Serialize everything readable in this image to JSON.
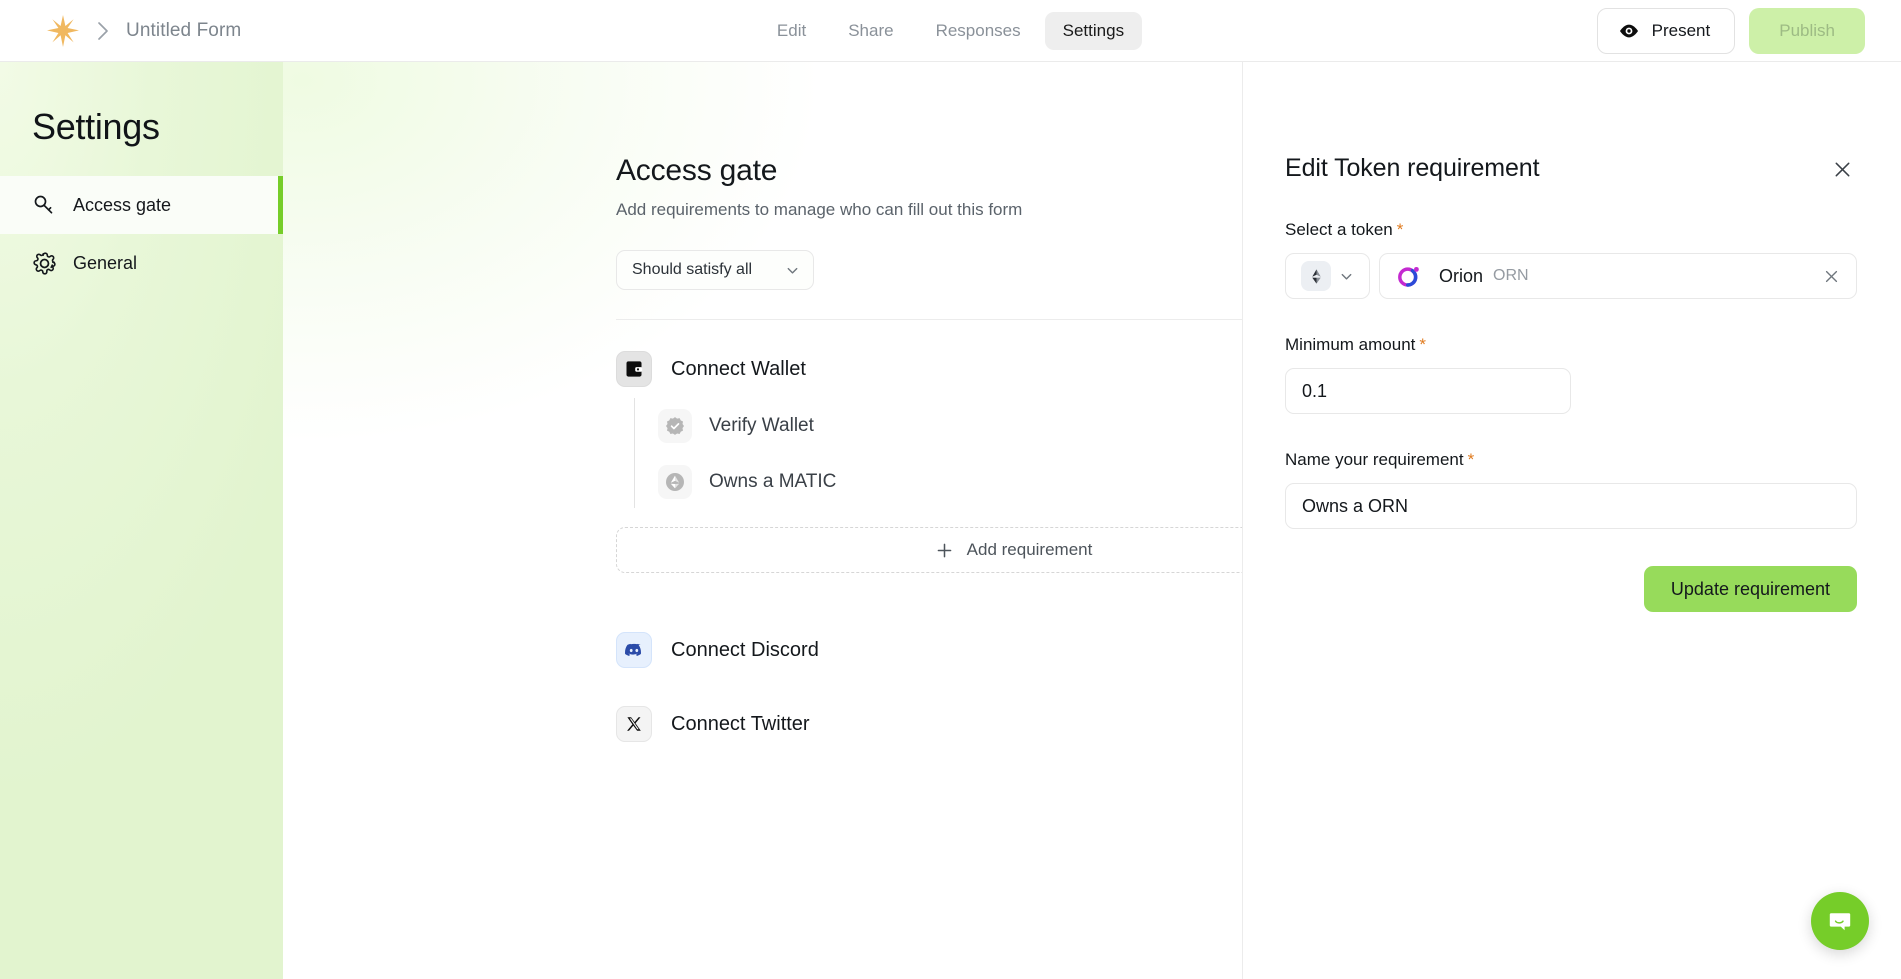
{
  "topbar": {
    "logo_icon": "star-burst-logo",
    "breadcrumb_separator": "chevron-right-icon",
    "form_title": "Untitled Form",
    "tabs": [
      {
        "label": "Edit",
        "active": false
      },
      {
        "label": "Share",
        "active": false
      },
      {
        "label": "Responses",
        "active": false
      },
      {
        "label": "Settings",
        "active": true
      }
    ],
    "present_label": "Present",
    "present_icon": "eye-icon",
    "publish_label": "Publish"
  },
  "sidebar": {
    "title": "Settings",
    "items": [
      {
        "label": "Access gate",
        "icon": "key-icon",
        "active": true
      },
      {
        "label": "General",
        "icon": "gear-icon",
        "active": false
      }
    ],
    "active_indicator_color": "#76cd29"
  },
  "main": {
    "heading": "Access gate",
    "subheading": "Add requirements to manage who can fill out this form",
    "logic_select": {
      "value": "Should satisfy all",
      "chevron": "chevron-down-icon"
    },
    "requirements": [
      {
        "label": "Connect Wallet",
        "icon": "wallet-icon",
        "enabled": true,
        "sub_requirements": [
          {
            "label": "Verify Wallet",
            "icon": "verified-badge-icon"
          },
          {
            "label": "Owns a MATIC",
            "icon": "ethereum-diamond-icon"
          }
        ]
      },
      {
        "label": "Connect Discord",
        "icon": "discord-icon",
        "enabled": false,
        "sub_requirements": []
      },
      {
        "label": "Connect Twitter",
        "icon": "twitter-x-icon",
        "enabled": false,
        "sub_requirements": []
      }
    ],
    "add_requirement_label": "Add requirement",
    "add_requirement_icon": "plus-icon"
  },
  "panel": {
    "title": "Edit Token requirement",
    "close_icon": "close-icon",
    "required_marker": "*",
    "token_field": {
      "label": "Select a token",
      "chain_icon": "ethereum-diamond-icon",
      "chain_chevron": "chevron-down-icon",
      "token_logo": "orion-logo-icon",
      "token_name": "Orion",
      "token_symbol": "ORN",
      "clear_icon": "close-icon"
    },
    "amount_field": {
      "label": "Minimum amount",
      "value": "0.1",
      "placeholder": "0"
    },
    "name_field": {
      "label": "Name your requirement",
      "value": "Owns a ORN",
      "placeholder": "Name your requirement"
    },
    "submit_label": "Update requirement",
    "submit_color": "#97db5b"
  },
  "chat": {
    "icon": "chat-bubble-icon",
    "color": "#76cd29"
  }
}
